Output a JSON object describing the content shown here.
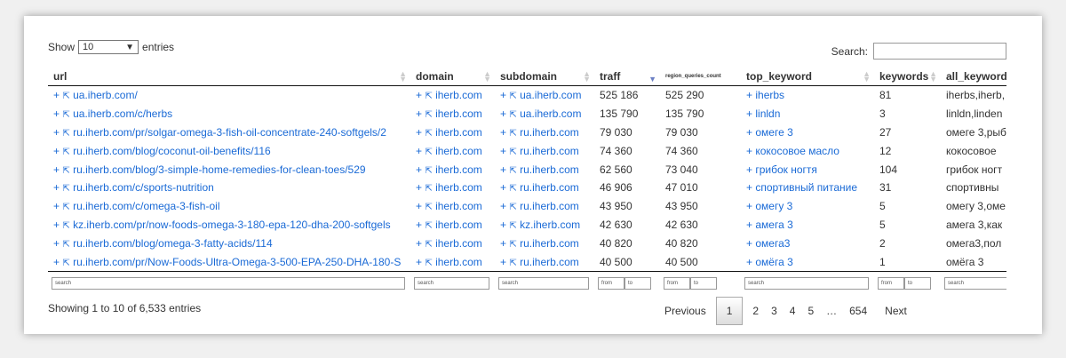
{
  "length": {
    "show": "Show",
    "value": "10",
    "entries": "entries"
  },
  "search": {
    "label": "Search:"
  },
  "columns": [
    "url",
    "domain",
    "subdomain",
    "traff",
    "region_queries_count",
    "top_keyword",
    "keywords",
    "all_keywords"
  ],
  "rows": [
    {
      "url": "ua.iherb.com/",
      "domain": "iherb.com",
      "subdomain": "ua.iherb.com",
      "traff": "525 186",
      "region": "525 290",
      "top": "iherbs",
      "kw": "81",
      "all": "iherbs,iherb,"
    },
    {
      "url": "ua.iherb.com/c/herbs",
      "domain": "iherb.com",
      "subdomain": "ua.iherb.com",
      "traff": "135 790",
      "region": "135 790",
      "top": "linldn",
      "kw": "3",
      "all": "linldn,linden"
    },
    {
      "url": "ru.iherb.com/pr/solgar-omega-3-fish-oil-concentrate-240-softgels/2",
      "domain": "iherb.com",
      "subdomain": "ru.iherb.com",
      "traff": "79 030",
      "region": "79 030",
      "top": "омеге 3",
      "kw": "27",
      "all": "омеге 3,рыб"
    },
    {
      "url": "ru.iherb.com/blog/coconut-oil-benefits/116",
      "domain": "iherb.com",
      "subdomain": "ru.iherb.com",
      "traff": "74 360",
      "region": "74 360",
      "top": "кокосовое масло",
      "kw": "12",
      "all": "кокосовое"
    },
    {
      "url": "ru.iherb.com/blog/3-simple-home-remedies-for-clean-toes/529",
      "domain": "iherb.com",
      "subdomain": "ru.iherb.com",
      "traff": "62 560",
      "region": "73 040",
      "top": "грибок ногтя",
      "kw": "104",
      "all": "грибок ногт"
    },
    {
      "url": "ru.iherb.com/c/sports-nutrition",
      "domain": "iherb.com",
      "subdomain": "ru.iherb.com",
      "traff": "46 906",
      "region": "47 010",
      "top": "спортивный питание",
      "kw": "31",
      "all": "спортивны"
    },
    {
      "url": "ru.iherb.com/c/omega-3-fish-oil",
      "domain": "iherb.com",
      "subdomain": "ru.iherb.com",
      "traff": "43 950",
      "region": "43 950",
      "top": "омегу 3",
      "kw": "5",
      "all": "омегу 3,оме"
    },
    {
      "url": "kz.iherb.com/pr/now-foods-omega-3-180-epa-120-dha-200-softgels",
      "domain": "iherb.com",
      "subdomain": "kz.iherb.com",
      "traff": "42 630",
      "region": "42 630",
      "top": "амега 3",
      "kw": "5",
      "all": "амега 3,как"
    },
    {
      "url": "ru.iherb.com/blog/omega-3-fatty-acids/114",
      "domain": "iherb.com",
      "subdomain": "ru.iherb.com",
      "traff": "40 820",
      "region": "40 820",
      "top": "омега3",
      "kw": "2",
      "all": "омега3,пол"
    },
    {
      "url": "ru.iherb.com/pr/Now-Foods-Ultra-Omega-3-500-EPA-250-DHA-180-S",
      "domain": "iherb.com",
      "subdomain": "ru.iherb.com",
      "traff": "40 500",
      "region": "40 500",
      "top": "омёга 3",
      "kw": "1",
      "all": "омёга 3"
    }
  ],
  "filters": {
    "search": "search",
    "from": "from",
    "to": "to"
  },
  "info": "Showing 1 to 10 of 6,533 entries",
  "pager": {
    "previous": "Previous",
    "pages": [
      "1",
      "2",
      "3",
      "4",
      "5"
    ],
    "ellipsis": "…",
    "last": "654",
    "next": "Next"
  },
  "icons": {
    "plus": "+",
    "external": "⇱"
  },
  "colors": {
    "link": "#1a6ad6",
    "sort_active": "#6b7fc4"
  }
}
